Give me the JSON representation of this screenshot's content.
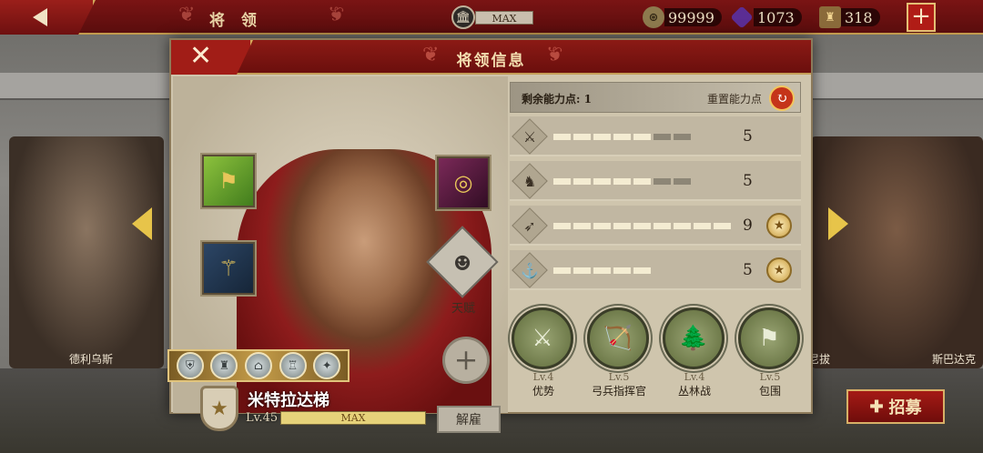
{
  "topbar": {
    "title": "将 领",
    "temple_max": "MAX",
    "gold": "99999",
    "gems": "1073",
    "medals": "318",
    "plus_label": "+"
  },
  "side": {
    "left_name": "德利乌斯",
    "right_name_a": "尼拔",
    "right_name_b": "斯巴达克"
  },
  "recruit_label": "招募",
  "dialog": {
    "title": "将领信息",
    "close_label": "✕",
    "talent_label": "天赋",
    "hero_name": "米特拉达梯",
    "level": "Lv.45",
    "xp_max": "MAX",
    "dismiss_label": "解雇",
    "points_label": "剩余能力点: 1",
    "reset_label": "重置能力点",
    "stats": [
      {
        "name": "infantry",
        "icon": "sword-icon",
        "value": "5",
        "filled": 5,
        "total": 7,
        "medal": false
      },
      {
        "name": "cavalry",
        "icon": "horse-icon",
        "value": "5",
        "filled": 5,
        "total": 7,
        "medal": false
      },
      {
        "name": "archer",
        "icon": "bow-icon",
        "value": "9",
        "filled": 9,
        "total": 9,
        "medal": true
      },
      {
        "name": "navy",
        "icon": "anchor-icon",
        "value": "5",
        "filled": 5,
        "total": 5,
        "medal": true
      }
    ],
    "skills": [
      {
        "lv": "Lv.4",
        "name": "优势",
        "glyph": "⚔"
      },
      {
        "lv": "Lv.5",
        "name": "弓兵指挥官",
        "glyph": "🏹"
      },
      {
        "lv": "Lv.4",
        "name": "丛林战",
        "glyph": "🌲"
      },
      {
        "lv": "Lv.5",
        "name": "包围",
        "glyph": "⚑"
      }
    ]
  },
  "colors": {
    "accent": "#8b1a15",
    "gold": "#c49c56"
  }
}
